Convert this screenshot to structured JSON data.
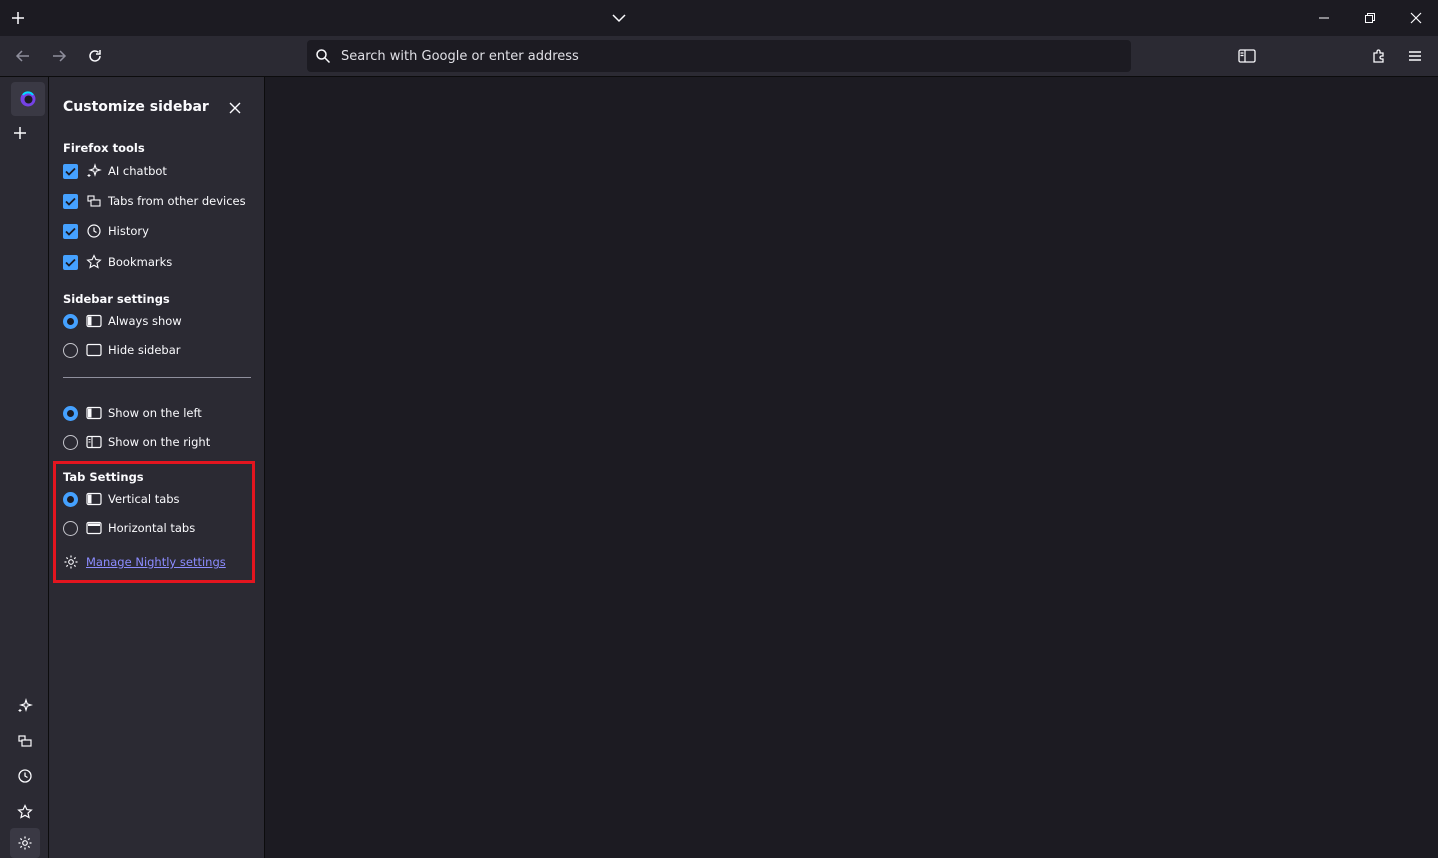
{
  "nav": {
    "url_placeholder": "Search with Google or enter address"
  },
  "panel": {
    "title": "Customize sidebar",
    "firefox_tools": {
      "heading": "Firefox tools",
      "items": [
        {
          "label": "AI chatbot",
          "checked": true
        },
        {
          "label": "Tabs from other devices",
          "checked": true
        },
        {
          "label": "History",
          "checked": true
        },
        {
          "label": "Bookmarks",
          "checked": true
        }
      ]
    },
    "sidebar_settings": {
      "heading": "Sidebar settings",
      "visibility": [
        {
          "label": "Always show",
          "selected": true
        },
        {
          "label": "Hide sidebar",
          "selected": false
        }
      ],
      "position": [
        {
          "label": "Show on the left",
          "selected": true
        },
        {
          "label": "Show on the right",
          "selected": false
        }
      ]
    },
    "tab_settings": {
      "heading": "Tab Settings",
      "items": [
        {
          "label": "Vertical tabs",
          "selected": true
        },
        {
          "label": "Horizontal tabs",
          "selected": false
        }
      ]
    },
    "manage_link": "Manage Nightly settings"
  },
  "colors": {
    "accent": "#45a1ff",
    "highlight_border": "#e3151f",
    "link": "#8c8cff"
  }
}
